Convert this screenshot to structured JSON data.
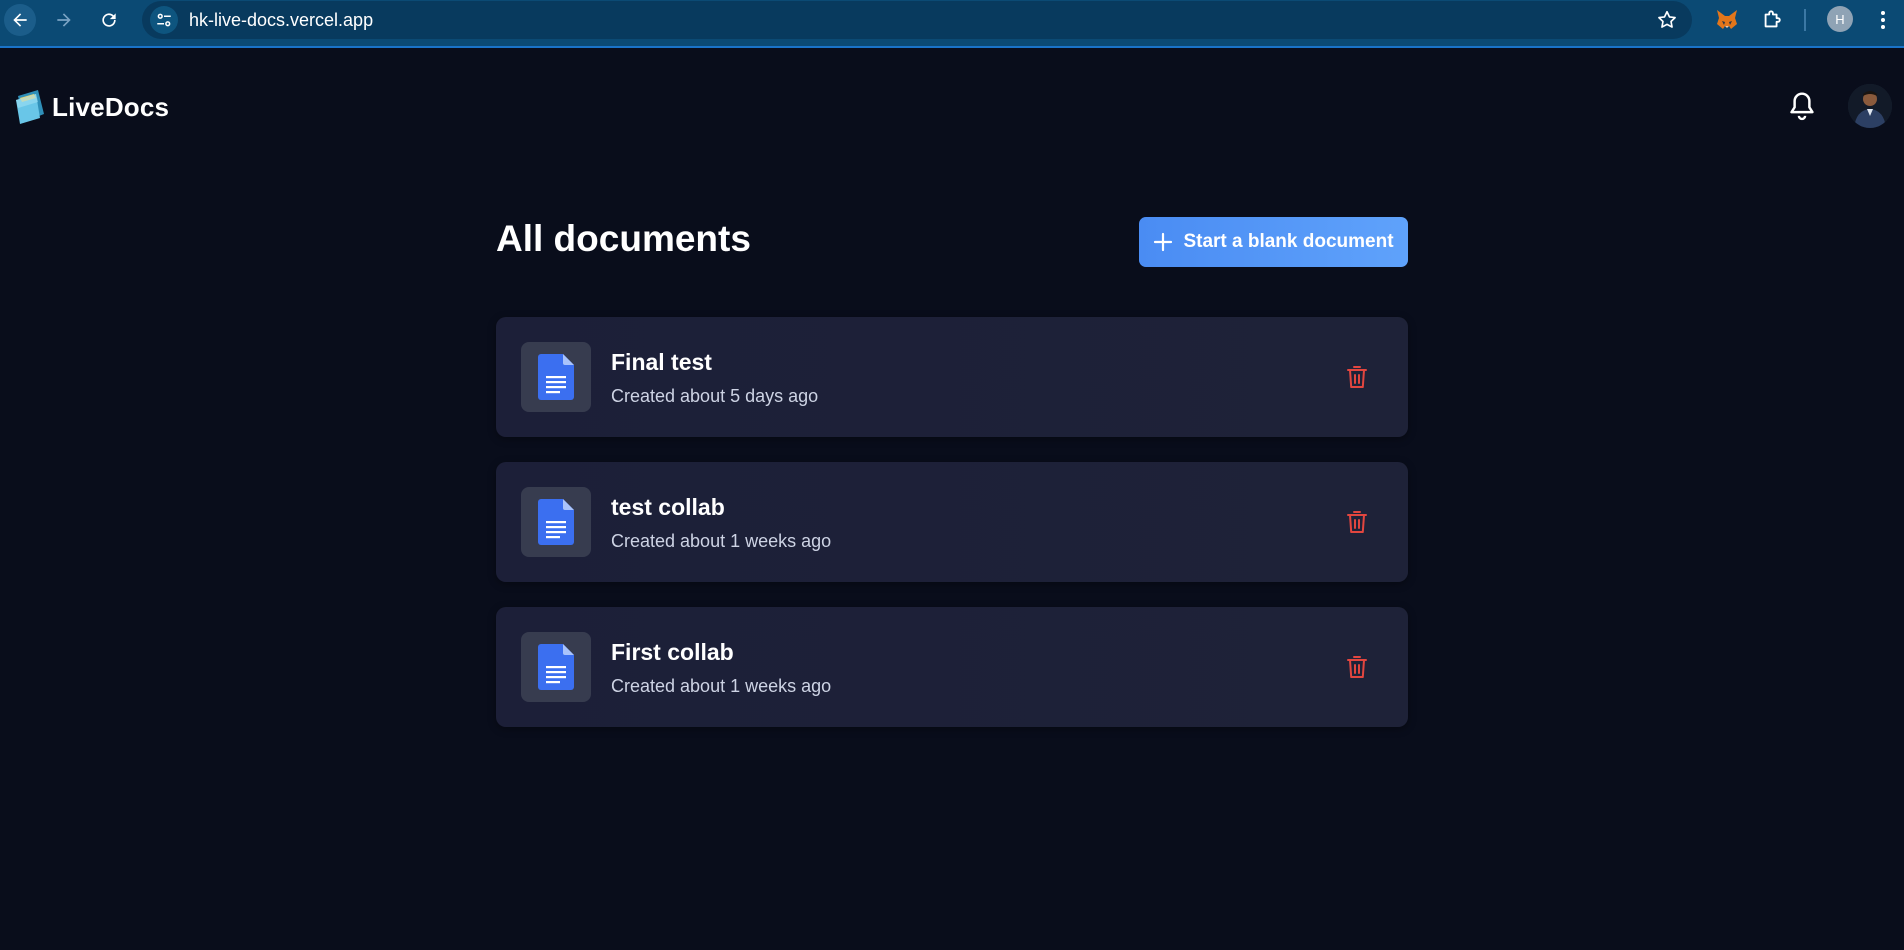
{
  "browser": {
    "url": "hk-live-docs.vercel.app",
    "profile_initial": "H"
  },
  "app": {
    "name": "LiveDocs"
  },
  "main": {
    "title": "All documents",
    "new_doc_label": "Start a blank document"
  },
  "documents": [
    {
      "title": "Final test",
      "created": "Created about 5 days ago"
    },
    {
      "title": "test collab",
      "created": "Created about 1 weeks ago"
    },
    {
      "title": "First collab",
      "created": "Created about 1 weeks ago"
    }
  ],
  "colors": {
    "background": "#090d1b",
    "accent": "#4a8cf3",
    "delete": "#e2463f",
    "doc_icon": "#3b6ff0"
  },
  "icons": {
    "back": "back-arrow-icon",
    "forward": "forward-arrow-icon",
    "reload": "reload-icon",
    "site_info": "tune-icon",
    "bookmark": "star-icon",
    "extension_1": "fox-icon",
    "extension_2": "puzzle-icon",
    "menu": "kebab-menu-icon",
    "notifications": "bell-icon",
    "new_doc": "plus-icon",
    "document": "document-icon",
    "delete": "trash-icon"
  }
}
